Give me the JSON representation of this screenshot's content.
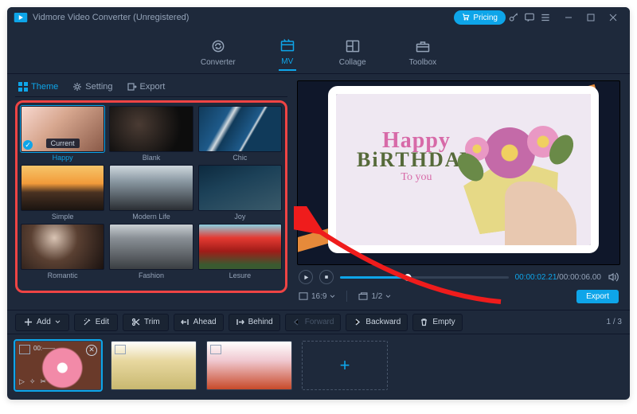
{
  "window": {
    "title": "Vidmore Video Converter (Unregistered)"
  },
  "titlebar": {
    "pricing": "Pricing"
  },
  "modes": {
    "converter": "Converter",
    "mv": "MV",
    "collage": "Collage",
    "toolbox": "Toolbox"
  },
  "subtabs": {
    "theme": "Theme",
    "setting": "Setting",
    "export": "Export"
  },
  "themes": {
    "current_tag": "Current",
    "happy": "Happy",
    "blank": "Blank",
    "chic": "Chic",
    "simple": "Simple",
    "modern": "Modern Life",
    "joy": "Joy",
    "romantic": "Romantic",
    "fashion": "Fashion",
    "lesure": "Lesure"
  },
  "preview": {
    "hb1": "Happy",
    "hb2": "BiRTHDAY",
    "hb3": "To you",
    "time_cur": "00:00:02.21",
    "time_tot": "/00:00:06.00",
    "aspect": "16:9",
    "page": "1/2"
  },
  "export_btn": "Export",
  "tools": {
    "add": "Add",
    "edit": "Edit",
    "trim": "Trim",
    "ahead": "Ahead",
    "behind": "Behind",
    "forward": "Forward",
    "backward": "Backward",
    "empty": "Empty",
    "pagecount": "1 / 3"
  },
  "clips": {
    "t1": "00:——"
  }
}
